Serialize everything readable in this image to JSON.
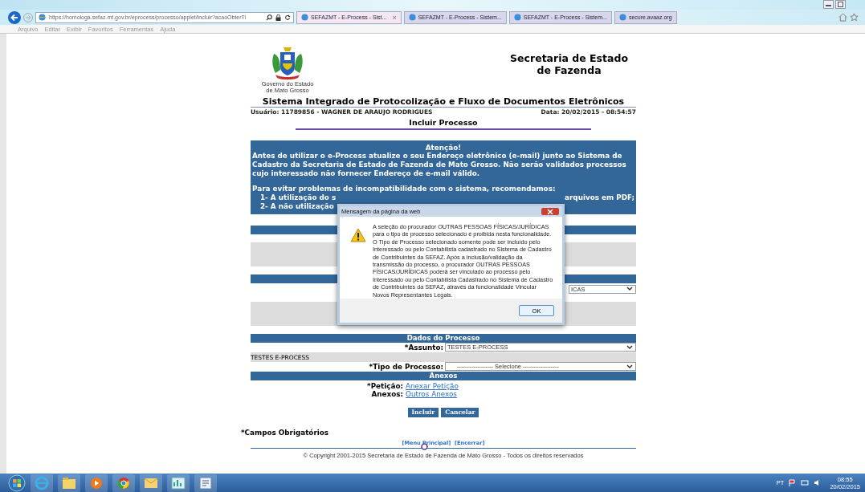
{
  "browser": {
    "address": "https://homologa.sefaz.mt.gov.br/eprocess/processo/applet/incluir?acaoObterTi",
    "tabs": [
      {
        "label": "SEFAZMT - E-Process - Sist...",
        "selected": true,
        "close": "×"
      },
      {
        "label": "SEFAZMT - E-Process - Sistem...",
        "selected": false
      },
      {
        "label": "SEFAZMT - E-Process - Sistem...",
        "selected": false
      },
      {
        "label": "secure.avaaz.org",
        "selected": false
      }
    ],
    "menu": [
      "Arquivo",
      "Editar",
      "Exibir",
      "Favoritos",
      "Ferramentas",
      "Ajuda"
    ]
  },
  "header": {
    "gov": [
      "Governo do Estado",
      "de Mato Grosso"
    ],
    "secretaria": [
      "Secretaria de Estado",
      "de Fazenda"
    ],
    "system": "Sistema Integrado de Protocolização e Fluxo de Documentos Eletrônicos",
    "user": "Usuário: 11789856 - WAGNER DE ARAUJO RODRIGUES",
    "date": "Data: 20/02/2015 - 08:54:57",
    "page_title": "Incluir Processo"
  },
  "notice": {
    "title": "Atenção!",
    "text": "Antes de utilizar o e-Process atualize o seu Endereço eletrônico (e-mail) junto ao Sistema de Cadastro da Secretaria de Estado de Fazenda de Mato Grosso. Não serão validados processos cujo interessado não fornecer Endereço de e-mail válido.",
    "recommend": "Para evitar problemas de incompatibilidade com o sistema, recomendamos:",
    "item_1_start": "1- A utilização do s",
    "item_1_end": "arquivos em PDF;",
    "item_2_start": "2- A não utilização"
  },
  "hidden_select_value": "ICAS",
  "dados": {
    "title": "Dados do Processo",
    "assunto_label": "*Assunto:",
    "assunto_value": "TESTES E-PROCESS",
    "assunto_echo": "TESTES E-PROCESS",
    "tipo_label": "*Tipo de Processo:",
    "tipo_value": "------------------ Selecione ------------------"
  },
  "anexos": {
    "title": "Anexos",
    "rows": [
      {
        "label": "*Petição:",
        "link": "Anexar Petição"
      },
      {
        "label": "Anexos:",
        "link": "Outros Anexos"
      }
    ]
  },
  "buttons": [
    "Incluir",
    "Cancelar"
  ],
  "required_note": "*Campos Obrigatórios",
  "footer_links": [
    "[Menu Principal]",
    "[Encerrar]"
  ],
  "copyright": "© Copyright 2001-2015 Secretaria de Estado de Fazenda de Mato Grosso - Todos os direitos reservados",
  "dialog": {
    "title": "Mensagem da página da web",
    "message": "A seleção do procurador OUTRAS PESSOAS FÍSICAS/JURÍDICAS para o tipo de processo selecionado é proibida nesta funcionalidade. O Tipo de Processo selecionado somente pode ser incluído pelo Interessado ou pelo Contabilista cadastrado no Sistema de Cadastro de Contribuintes da SEFAZ. Após a inclusão/validação da transmissão do processo, o procurador OUTRAS PESSOAS FÍSICAS/JURÍDICAS poderá ser vinculado ao processo pelo Interessado ou pelo Contabilista Cadastrado no Sistema de Cadastro de Contribuintes da SEFAZ, através da funcionalidade Vincular Novos Representantes Legais.",
    "ok": "OK"
  },
  "taskbar": {
    "language": "PT",
    "time": "08:55",
    "date": "20/02/2015"
  }
}
